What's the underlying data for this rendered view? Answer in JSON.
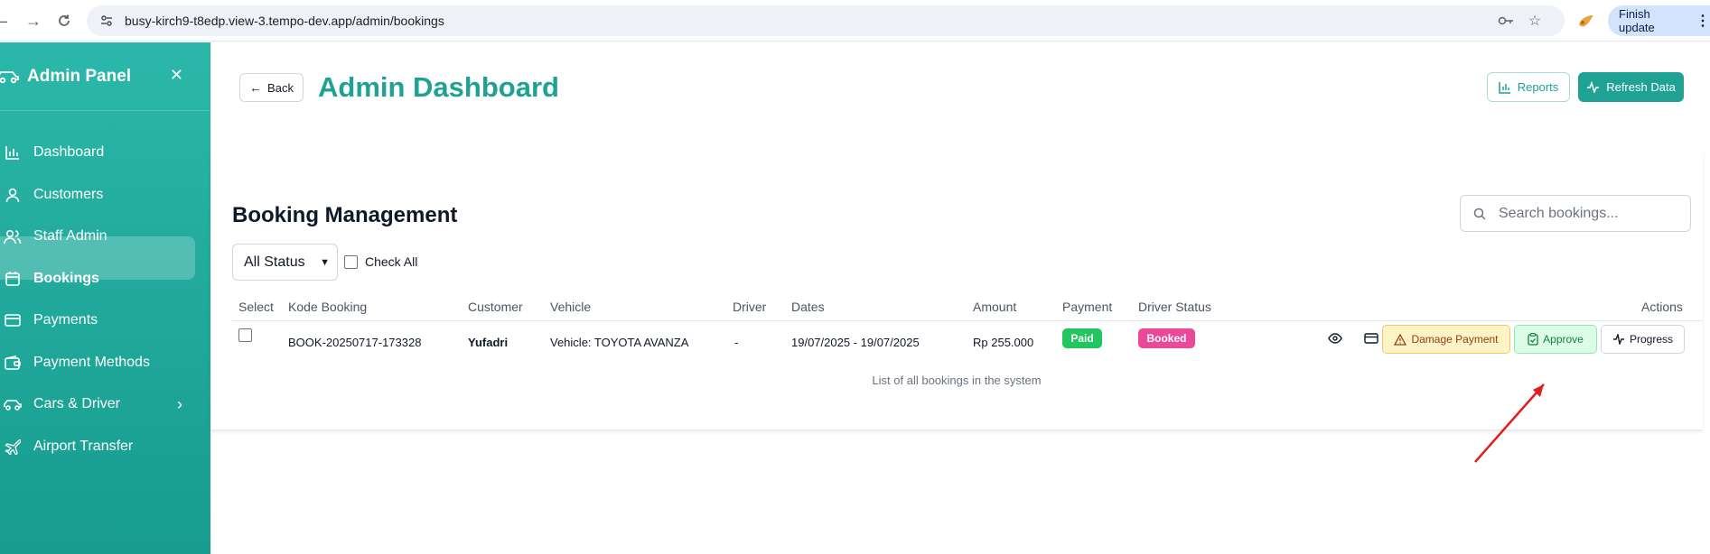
{
  "browser": {
    "url": "busy-kirch9-t8edp.view-3.tempo-dev.app/admin/bookings",
    "finish_update_label": "Finish update"
  },
  "sidebar": {
    "title": "Admin Panel",
    "items": [
      {
        "label": "Dashboard",
        "icon": "bar-chart-icon"
      },
      {
        "label": "Customers",
        "icon": "user-icon"
      },
      {
        "label": "Staff Admin",
        "icon": "users-icon"
      },
      {
        "label": "Bookings",
        "icon": "calendar-icon",
        "active": true
      },
      {
        "label": "Payments",
        "icon": "credit-card-icon"
      },
      {
        "label": "Payment Methods",
        "icon": "wallet-icon"
      },
      {
        "label": "Cars & Driver",
        "icon": "car-icon",
        "has_submenu": true
      },
      {
        "label": "Airport Transfer",
        "icon": "plane-icon"
      }
    ]
  },
  "header": {
    "back_label": "Back",
    "title": "Admin Dashboard",
    "reports_label": "Reports",
    "refresh_label": "Refresh Data"
  },
  "bookings": {
    "title": "Booking Management",
    "search_placeholder": "Search bookings...",
    "status_filter": "All Status",
    "check_all_label": "Check All",
    "columns": [
      "Select",
      "Kode Booking",
      "Customer",
      "Vehicle",
      "Driver",
      "Dates",
      "Amount",
      "Payment",
      "Driver Status",
      "Actions"
    ],
    "rows": [
      {
        "code": "BOOK-20250717-173328",
        "customer": "Yufadri",
        "vehicle": "Vehicle: TOYOTA AVANZA",
        "driver": "-",
        "dates": "19/07/2025 - 19/07/2025",
        "amount": "Rp 255.000",
        "payment": "Paid",
        "driver_status": "Booked"
      }
    ],
    "actions": {
      "damage_payment": "Damage Payment",
      "approve": "Approve",
      "progress": "Progress"
    },
    "caption": "List of all bookings in the system"
  },
  "colors": {
    "brand": "#1fa293",
    "paid": "#22c55e",
    "booked": "#ec4899",
    "annotation_arrow": "#e11d1d"
  }
}
